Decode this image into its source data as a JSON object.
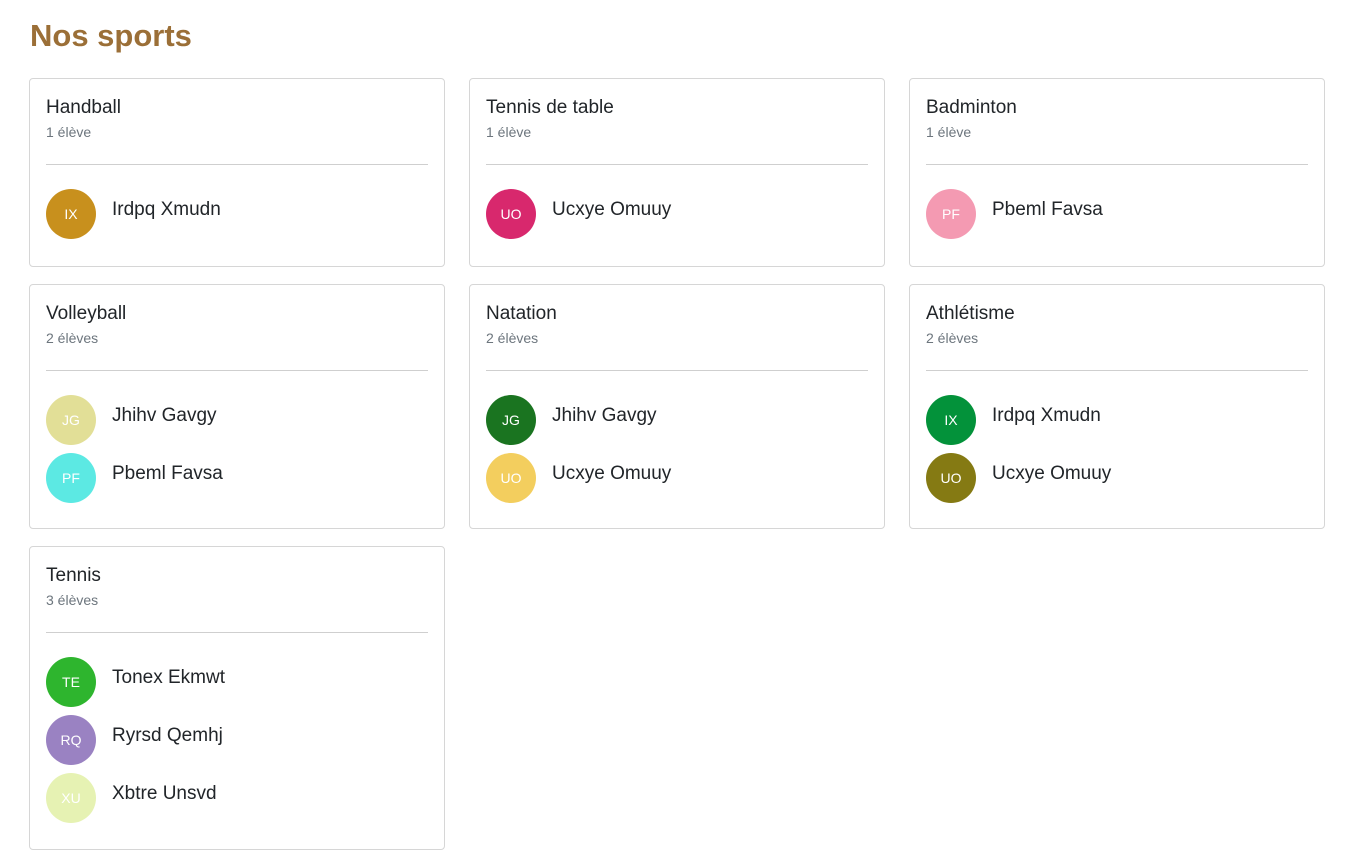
{
  "page": {
    "title": "Nos sports"
  },
  "sports": [
    {
      "name": "Handball",
      "count": "1 élève",
      "students": [
        {
          "initials": "IX",
          "name": "Irdpq Xmudn",
          "color": "#c8901d"
        }
      ]
    },
    {
      "name": "Tennis de table",
      "count": "1 élève",
      "students": [
        {
          "initials": "UO",
          "name": "Ucxye Omuuy",
          "color": "#d8286d"
        }
      ]
    },
    {
      "name": "Badminton",
      "count": "1 élève",
      "students": [
        {
          "initials": "PF",
          "name": "Pbeml Favsa",
          "color": "#f49ab2"
        }
      ]
    },
    {
      "name": "Volleyball",
      "count": "2 élèves",
      "students": [
        {
          "initials": "JG",
          "name": "Jhihv Gavgy",
          "color": "#e2df97"
        },
        {
          "initials": "PF",
          "name": "Pbeml Favsa",
          "color": "#5ce9e3"
        }
      ]
    },
    {
      "name": "Natation",
      "count": "2 élèves",
      "students": [
        {
          "initials": "JG",
          "name": "Jhihv Gavgy",
          "color": "#1a7420"
        },
        {
          "initials": "UO",
          "name": "Ucxye Omuuy",
          "color": "#f3ce5e"
        }
      ]
    },
    {
      "name": "Athlétisme",
      "count": "2 élèves",
      "students": [
        {
          "initials": "IX",
          "name": "Irdpq Xmudn",
          "color": "#03923a"
        },
        {
          "initials": "UO",
          "name": "Ucxye Omuuy",
          "color": "#857a13"
        }
      ]
    },
    {
      "name": "Tennis",
      "count": "3 élèves",
      "students": [
        {
          "initials": "TE",
          "name": "Tonex Ekmwt",
          "color": "#2eb52e"
        },
        {
          "initials": "RQ",
          "name": "Ryrsd Qemhj",
          "color": "#9a82c2"
        },
        {
          "initials": "XU",
          "name": "Xbtre Unsvd",
          "color": "#e6f2b3"
        }
      ]
    }
  ]
}
